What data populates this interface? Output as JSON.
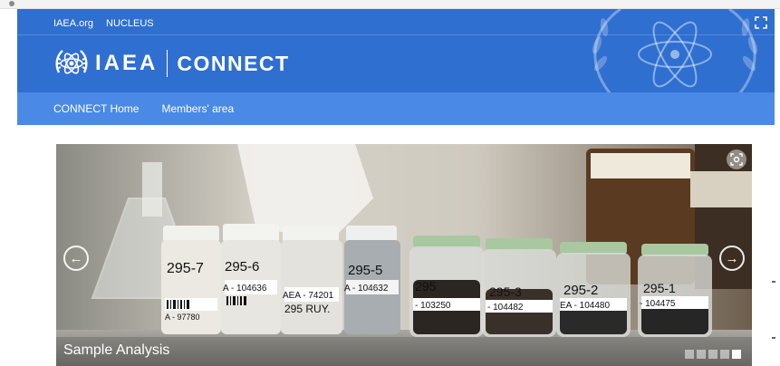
{
  "header": {
    "top_links": [
      "IAEA.org",
      "NUCLEUS"
    ],
    "brand_name": "IAEA",
    "brand_product": "CONNECT"
  },
  "subnav": {
    "items": [
      "CONNECT Home",
      "Members' area"
    ]
  },
  "slider": {
    "caption": "Sample Analysis",
    "slide_count": 5,
    "active_slide": 5,
    "labels": {
      "b1": [
        "295-7",
        "A - 97780"
      ],
      "b2": [
        "295-6",
        "A - 104636"
      ],
      "b3": [
        "AEA - 74201",
        "295 RUY."
      ],
      "b4": [
        "295-5",
        "A - 104632"
      ],
      "j1": [
        "295",
        "- 103250"
      ],
      "j2": [
        "295-3",
        "- 104482"
      ],
      "j3": [
        "295-2",
        "EA - 104480"
      ],
      "j4": [
        "295-1",
        "- 104475"
      ]
    }
  },
  "colors": {
    "header_bg": "#2f6fd0",
    "subnav_bg": "#4a8ae6",
    "text": "#ffffff"
  }
}
